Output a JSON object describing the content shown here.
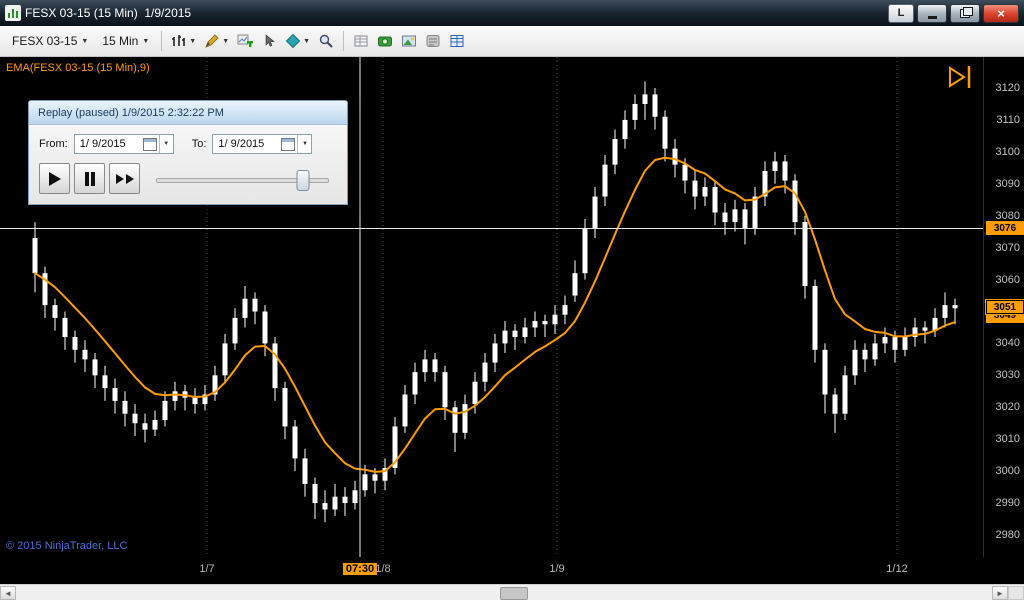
{
  "window": {
    "title": "FESX 03-15 (15 Min)  1/9/2015",
    "link_button": "L"
  },
  "icons": {
    "dropdown": "▼",
    "close": "×",
    "left_arrow": "◄",
    "right_arrow": "►"
  },
  "toolbar": {
    "instrument": "FESX 03-15",
    "interval": "15 Min"
  },
  "replay": {
    "title": "Replay (paused) 1/9/2015 2:32:22 PM",
    "from_label": "From:",
    "from_value": "1/ 9/2015",
    "to_label": "To:",
    "to_value": "1/ 9/2015",
    "progress": 0.85
  },
  "chart": {
    "indicator_label": "EMA(FESX 03-15 (15 Min),9)",
    "copyright": "© 2015 NinjaTrader, LLC",
    "crosshair": {
      "price": 3076,
      "bar_pos": 32.5
    },
    "last_price": 3051,
    "prev_price": 3049,
    "colors": {
      "ema": "#FF9C00",
      "bar": "#FFFFFF",
      "tag_bg": "#FF9C00",
      "grid": "#4a4a4a",
      "crosshair": "#e8e8e8"
    }
  },
  "chart_data": {
    "type": "candlestick",
    "title": "FESX 03-15 (15 Min)",
    "ylim": [
      2980,
      3120
    ],
    "y_step": 10,
    "ema_period": 9,
    "x_ticks": [
      {
        "label": "1/7",
        "pos": 17.2,
        "gridline": true,
        "highlight": false
      },
      {
        "label": "07:30",
        "pos": 32.5,
        "gridline": false,
        "highlight": true
      },
      {
        "label": "1/8",
        "pos": 34.8,
        "gridline": true,
        "highlight": false
      },
      {
        "label": "1/9",
        "pos": 52.2,
        "gridline": true,
        "highlight": false
      },
      {
        "label": "1/12",
        "pos": 86.2,
        "gridline": true,
        "highlight": false
      }
    ],
    "bars_ohlc": [
      [
        3073,
        3078,
        3056,
        3062
      ],
      [
        3062,
        3064,
        3048,
        3052
      ],
      [
        3052,
        3054,
        3044,
        3048
      ],
      [
        3048,
        3050,
        3038,
        3042
      ],
      [
        3042,
        3044,
        3034,
        3038
      ],
      [
        3038,
        3041,
        3031,
        3035
      ],
      [
        3035,
        3037,
        3026,
        3030
      ],
      [
        3030,
        3033,
        3022,
        3026
      ],
      [
        3026,
        3029,
        3018,
        3022
      ],
      [
        3022,
        3025,
        3014,
        3018
      ],
      [
        3018,
        3021,
        3011,
        3015
      ],
      [
        3015,
        3018,
        3009,
        3013
      ],
      [
        3013,
        3019,
        3011,
        3016
      ],
      [
        3016,
        3025,
        3014,
        3022
      ],
      [
        3022,
        3028,
        3019,
        3025
      ],
      [
        3025,
        3027,
        3019,
        3023
      ],
      [
        3023,
        3026,
        3018,
        3021
      ],
      [
        3021,
        3027,
        3019,
        3024
      ],
      [
        3024,
        3033,
        3022,
        3030
      ],
      [
        3030,
        3043,
        3028,
        3040
      ],
      [
        3040,
        3051,
        3038,
        3048
      ],
      [
        3048,
        3058,
        3045,
        3054
      ],
      [
        3054,
        3056,
        3046,
        3050
      ],
      [
        3050,
        3052,
        3036,
        3040
      ],
      [
        3040,
        3042,
        3022,
        3026
      ],
      [
        3026,
        3028,
        3010,
        3014
      ],
      [
        3014,
        3016,
        3000,
        3004
      ],
      [
        3004,
        3007,
        2992,
        2996
      ],
      [
        2996,
        2998,
        2985,
        2990
      ],
      [
        2990,
        2994,
        2984,
        2988
      ],
      [
        2988,
        2996,
        2986,
        2992
      ],
      [
        2992,
        2995,
        2986,
        2990
      ],
      [
        2990,
        2997,
        2988,
        2994
      ],
      [
        2994,
        3002,
        2992,
        2999
      ],
      [
        2999,
        3001,
        2993,
        2997
      ],
      [
        2997,
        3004,
        2994,
        3001
      ],
      [
        3001,
        3017,
        2999,
        3014
      ],
      [
        3014,
        3027,
        3012,
        3024
      ],
      [
        3024,
        3034,
        3021,
        3031
      ],
      [
        3031,
        3038,
        3028,
        3035
      ],
      [
        3035,
        3037,
        3028,
        3031
      ],
      [
        3031,
        3033,
        3016,
        3020
      ],
      [
        3020,
        3022,
        3006,
        3012
      ],
      [
        3012,
        3024,
        3010,
        3021
      ],
      [
        3021,
        3031,
        3018,
        3028
      ],
      [
        3028,
        3037,
        3025,
        3034
      ],
      [
        3034,
        3043,
        3031,
        3040
      ],
      [
        3040,
        3047,
        3037,
        3044
      ],
      [
        3044,
        3046,
        3038,
        3042
      ],
      [
        3042,
        3048,
        3040,
        3045
      ],
      [
        3045,
        3050,
        3042,
        3047
      ],
      [
        3047,
        3049,
        3042,
        3046
      ],
      [
        3046,
        3052,
        3043,
        3049
      ],
      [
        3049,
        3055,
        3046,
        3052
      ],
      [
        3055,
        3066,
        3053,
        3062
      ],
      [
        3062,
        3079,
        3060,
        3076
      ],
      [
        3076,
        3089,
        3073,
        3086
      ],
      [
        3086,
        3099,
        3083,
        3096
      ],
      [
        3096,
        3107,
        3093,
        3104
      ],
      [
        3104,
        3113,
        3101,
        3110
      ],
      [
        3110,
        3118,
        3107,
        3115
      ],
      [
        3115,
        3122,
        3110,
        3118
      ],
      [
        3118,
        3120,
        3107,
        3111
      ],
      [
        3111,
        3113,
        3097,
        3101
      ],
      [
        3101,
        3104,
        3092,
        3096
      ],
      [
        3096,
        3098,
        3087,
        3091
      ],
      [
        3091,
        3094,
        3082,
        3086
      ],
      [
        3086,
        3092,
        3083,
        3089
      ],
      [
        3089,
        3091,
        3077,
        3081
      ],
      [
        3081,
        3084,
        3074,
        3078
      ],
      [
        3078,
        3085,
        3075,
        3082
      ],
      [
        3082,
        3084,
        3071,
        3076
      ],
      [
        3076,
        3089,
        3074,
        3086
      ],
      [
        3086,
        3097,
        3083,
        3094
      ],
      [
        3094,
        3100,
        3090,
        3097
      ],
      [
        3097,
        3099,
        3087,
        3091
      ],
      [
        3091,
        3093,
        3074,
        3078
      ],
      [
        3078,
        3080,
        3054,
        3058
      ],
      [
        3058,
        3060,
        3034,
        3038
      ],
      [
        3038,
        3040,
        3018,
        3024
      ],
      [
        3024,
        3026,
        3012,
        3018
      ],
      [
        3018,
        3033,
        3016,
        3030
      ],
      [
        3030,
        3041,
        3027,
        3038
      ],
      [
        3038,
        3040,
        3031,
        3035
      ],
      [
        3035,
        3043,
        3033,
        3040
      ],
      [
        3040,
        3045,
        3037,
        3042
      ],
      [
        3042,
        3044,
        3034,
        3038
      ],
      [
        3038,
        3045,
        3036,
        3042
      ],
      [
        3042,
        3048,
        3039,
        3045
      ],
      [
        3045,
        3047,
        3040,
        3044
      ],
      [
        3044,
        3051,
        3042,
        3048
      ],
      [
        3048,
        3056,
        3045,
        3052
      ],
      [
        3052,
        3054,
        3046,
        3051
      ]
    ]
  }
}
